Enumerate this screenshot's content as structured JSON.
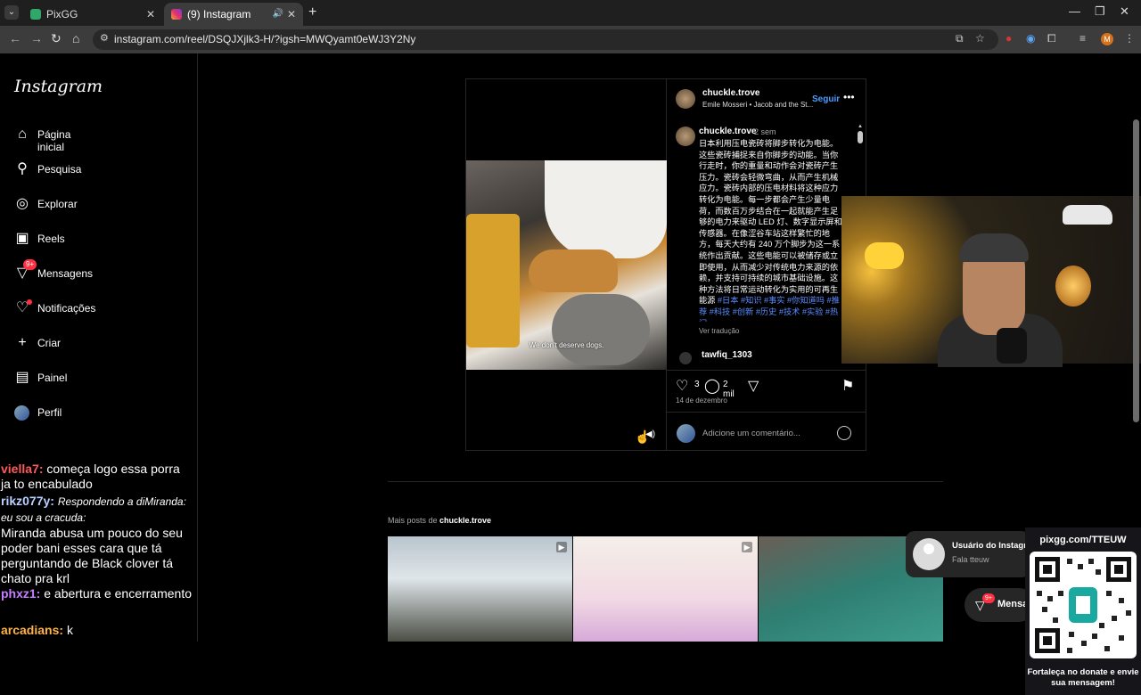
{
  "browser": {
    "tabs": [
      {
        "title": "PixGG",
        "favicon_color": "#4fc3f7"
      },
      {
        "title": "(9) Instagram",
        "favicon_color": "#e1306c"
      }
    ],
    "url": "instagram.com/reel/DSQJXjlk3-H/?igsh=MWQyamt0eWJ3Y2Ny",
    "profile_initial": "M"
  },
  "sidebar": {
    "logo": "Instagram",
    "items": [
      {
        "label": "Página inicial",
        "icon": "home-icon"
      },
      {
        "label": "Pesquisa",
        "icon": "search-icon"
      },
      {
        "label": "Explorar",
        "icon": "compass-icon"
      },
      {
        "label": "Reels",
        "icon": "reels-icon"
      },
      {
        "label": "Mensagens",
        "icon": "messenger-icon",
        "badge": "9+"
      },
      {
        "label": "Notificações",
        "icon": "heart-icon"
      },
      {
        "label": "Criar",
        "icon": "plus-icon"
      },
      {
        "label": "Painel",
        "icon": "dashboard-icon"
      },
      {
        "label": "Perfil",
        "icon": "avatar"
      }
    ]
  },
  "chat": [
    {
      "user": "viella7:",
      "color": "#ff5a5a",
      "text": "começa logo essa porra ja to encabulado"
    },
    {
      "user": "rikz077y:",
      "color": "#9ab8ff",
      "reply": "Respondendo a diMiranda: eu sou a cracuda:",
      "text": "Miranda abusa um pouco do seu poder bani esses cara que tá perguntando de Black clover tá chato pra krl"
    },
    {
      "user": "phxz1:",
      "color": "#c77dff",
      "text": "e abertura e encerramento"
    },
    {
      "user": "arcadians:",
      "color": "#ffb347",
      "text": "k"
    }
  ],
  "reel": {
    "subtitle": "We don't deserve dogs."
  },
  "post": {
    "username": "chuckle.trove",
    "audio": "Emile Mosseri • Jacob and the St...",
    "follow": "Seguir",
    "caption_user": "chuckle.trove",
    "caption_time": "2 sem",
    "caption": "日本利用压电瓷砖将脚步转化为电能。这些瓷砖捕捉来自你脚步的动能。当你行走时，你的重量和动作会对瓷砖产生压力。瓷砖会轻微弯曲，从而产生机械应力。瓷砖内部的压电材料将这种应力转化为电能。每一步都会产生少量电荷，而数百万步结合在一起就能产生足够的电力来驱动 LED 灯、数字显示屏和传感器。在像涩谷车站这样繁忙的地方，每天大约有 240 万个脚步为这一系统作出贡献。这些电能可以被储存或立即使用，从而减少对传统电力来源的依赖，并支持可持续的城市基础设施。这种方法将日常运动转化为实用的可再生能源",
    "tags": "#日本 #知识 #事实 #你知道吗 #推荐 #科技 #创新 #历史 #技术 #实验 #热门",
    "translate": "Ver tradução",
    "comment_user": "tawfiq_1303",
    "likes": "3",
    "comments": "2 mil",
    "date": "14 de dezembro",
    "comment_placeholder": "Adicione um comentário..."
  },
  "more_posts": {
    "prefix": "Mais posts de ",
    "user": "chuckle.trove"
  },
  "overlay": {
    "notif_title": "Usuário do Instagram",
    "notif_text": "Fala tteuw",
    "messages_badge": "9+",
    "messages_label": "Mensa",
    "qr_url": "pixgg.com/TTEUW",
    "qr_message": "Fortaleça no donate e envie sua mensagem!"
  },
  "colors": {
    "accent_blue": "#4a9cff",
    "badge_red": "#ff3040"
  }
}
